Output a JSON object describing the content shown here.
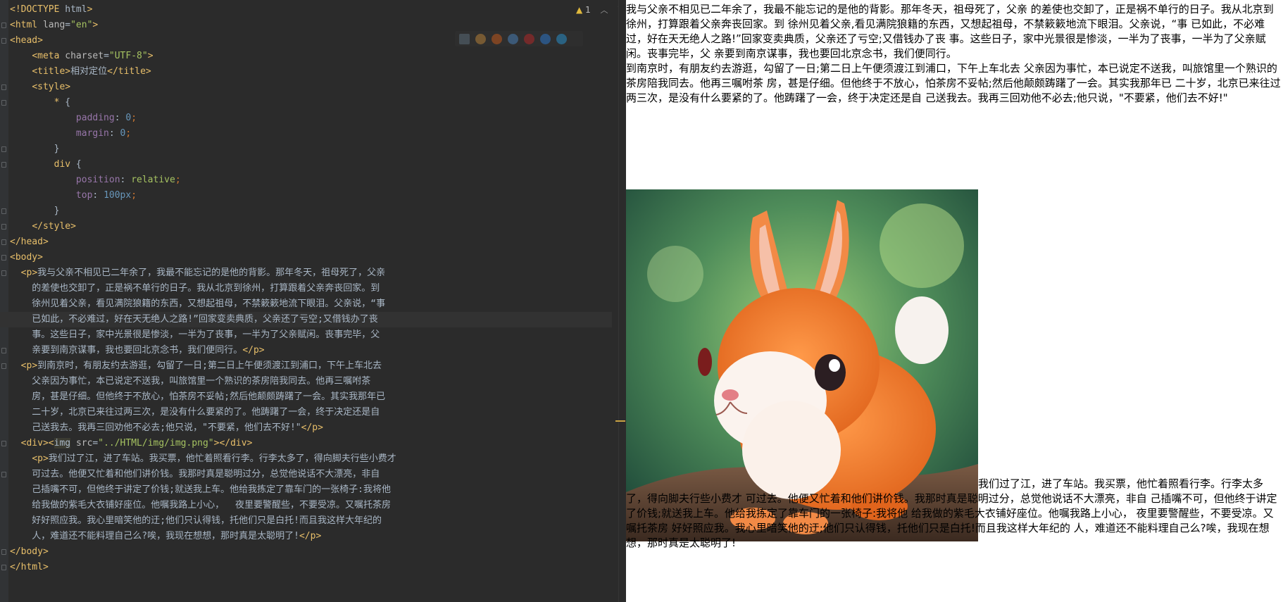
{
  "editor": {
    "inspection": {
      "count": "1",
      "icon": "warning-icon"
    },
    "browser_icons": [
      {
        "name": "intellij-preview-icon",
        "color": "#5c6b78"
      },
      {
        "name": "chrome-icon",
        "color": "#b5813a"
      },
      {
        "name": "firefox-icon",
        "color": "#c05a1e"
      },
      {
        "name": "safari-icon",
        "color": "#4a7fb5"
      },
      {
        "name": "opera-icon",
        "color": "#b02a2a"
      },
      {
        "name": "ie-icon",
        "color": "#2d77c8"
      },
      {
        "name": "edge-icon",
        "color": "#2a8fc9"
      }
    ],
    "lines": [
      "<!DOCTYPE html>",
      "<html lang=\"en\">",
      "<head>",
      "    <meta charset=\"UTF-8\">",
      "    <title>相对定位</title>",
      "    <style>",
      "        * {",
      "            padding: 0;",
      "            margin: 0;",
      "        }",
      "        div {",
      "            position: relative;",
      "            top: 100px;",
      "        }",
      "    </style>",
      "</head>",
      "<body>",
      "  <p>我与父亲不相见已二年余了，我最不能忘记的是他的背影。那年冬天，祖母死了，父亲",
      "    的差使也交卸了，正是祸不单行的日子。我从北京到徐州，打算跟着父亲奔丧回家。到",
      "    徐州见着父亲，看见满院狼籍的东西，又想起祖母，不禁簌簌地流下眼泪。父亲说，“事",
      "    已如此，不必难过，好在天无绝人之路!”回家变卖典质，父亲还了亏空;又借钱办了丧",
      "    事。这些日子，家中光景很是惨淡，一半为了丧事，一半为了父亲赋闲。丧事完毕，父",
      "    亲要到南京谋事，我也要回北京念书，我们便同行。</p>",
      "  <p>到南京时，有朋友约去游逛，勾留了一日;第二日上午便须渡江到浦口，下午上车北去",
      "    父亲因为事忙，本已说定不送我，叫旅馆里一个熟识的茶房陪我同去。他再三嘱咐茶",
      "    房，甚是仔细。但他终于不放心，怕茶房不妥帖;然后他颠颇踌躇了一会。其实我那年已",
      "    二十岁，北京已来往过两三次，是没有什么要紧的了。他踌躇了一会，终于决定还是自",
      "    己送我去。我再三回劝他不必去;他只说，\"不要紧，他们去不好!\"</p>",
      "  <div><img src=\"../HTML/img/img.png\"></div>",
      "    <p>我们过了江，进了车站。我买票，他忙着照看行李。行李太多了，得向脚夫行些小费才",
      "    可过去。他便又忙着和他们讲价钱。我那时真是聪明过分，总觉他说话不大漂亮，非自",
      "    己插嘴不可，但他终于讲定了价钱;就送我上车。他给我拣定了靠车门的一张椅子:我将他",
      "    给我做的紫毛大衣铺好座位。他嘱我路上小心，  夜里要警醒些，不要受凉。又嘱托茶房",
      "    好好照应我。我心里暗笑他的迂;他们只认得钱，托他们只是白托!而且我这样大年纪的",
      "    人，难道还不能料理自己么?唉，我现在想想，那时真是太聪明了!</p>",
      "</body>",
      "</html>"
    ]
  },
  "preview": {
    "p1": "我与父亲不相见已二年余了，我最不能忘记的是他的背影。那年冬天，祖母死了，父亲 的差使也交卸了，正是祸不单行的日子。我从北京到徐州，打算跟着父亲奔丧回家。到 徐州见着父亲,看见满院狼籍的东西，又想起祖母，不禁簌簌地流下眼泪。父亲说，“事 已如此，不必难过，好在天无绝人之路!”回家变卖典质，父亲还了亏空;又借钱办了丧 事。这些日子，家中光景很是惨淡，一半为了丧事，一半为了父亲赋闲。丧事完毕，父 亲要到南京谋事，我也要回北京念书，我们便同行。",
    "p2": "到南京时，有朋友约去游逛，勾留了一日;第二日上午便须渡江到浦口，下午上车北去 父亲因为事忙，本已说定不送我，叫旅馆里一个熟识的茶房陪我同去。他再三嘱咐茶 房，甚是仔细。但他终于不放心，怕茶房不妥帖;然后他颠颇踌躇了一会。其实我那年已 二十岁，北京已来往过两三次，是没有什么要紧的了。他踌躇了一会，终于决定还是自 己送我去。我再三回劝他不必去;他只说，\"不要紧，他们去不好!\"",
    "p3": "我们过了江，进了车站。我买票，他忙着照看行李。行李太多了，得向脚夫行些小费才 可过去。他便又忙着和他们讲价钱。我那时真是聪明过分，总觉他说话不大漂亮，非自 己插嘴不可，但他终于讲定了价钱;就送我上车。他给我拣定了靠车门的一张椅子:我将他 给我做的紫毛大衣铺好座位。他嘱我路上小心， 夜里要警醒些，不要受凉。又嘱托茶房 好好照应我。我心里暗笑他的迂;他们只认得钱，托他们只是白托!而且我这样大年纪的 人，难道还不能料理自己么?唉，我现在想想，那时真是太聪明了!",
    "image": {
      "subject": "orange-rabbit-illustration"
    }
  }
}
